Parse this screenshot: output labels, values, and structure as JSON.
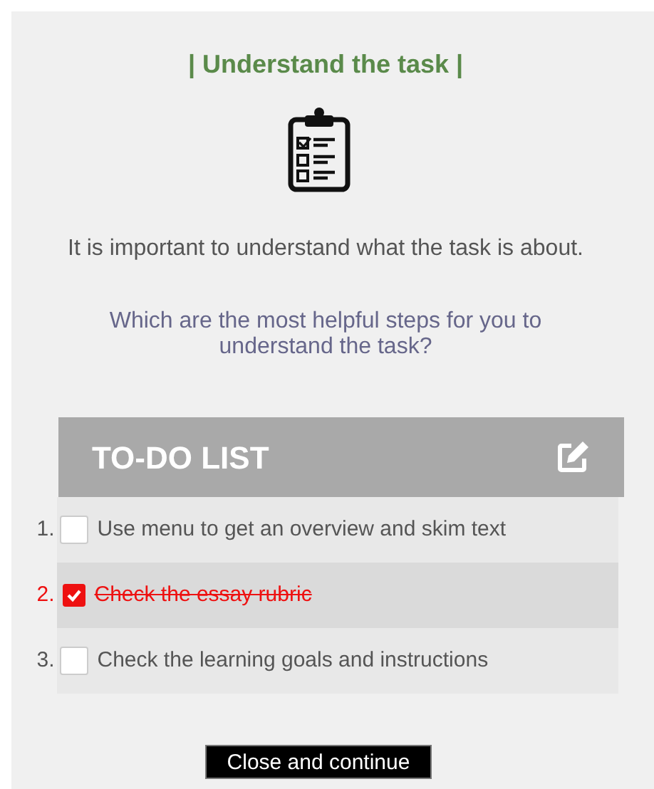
{
  "title": "| Understand the task |",
  "intro": "It is important to understand what the task is about.",
  "question": "Which are the most helpful steps for you to understand the task?",
  "todo": {
    "heading": "TO-DO LIST",
    "items": [
      {
        "number": "1.",
        "label": "Use menu to get an overview and skim text",
        "checked": false
      },
      {
        "number": "2.",
        "label": "Check the essay rubric",
        "checked": true
      },
      {
        "number": "3.",
        "label": "Check the learning goals and instructions",
        "checked": false
      }
    ]
  },
  "button": "Close and continue"
}
